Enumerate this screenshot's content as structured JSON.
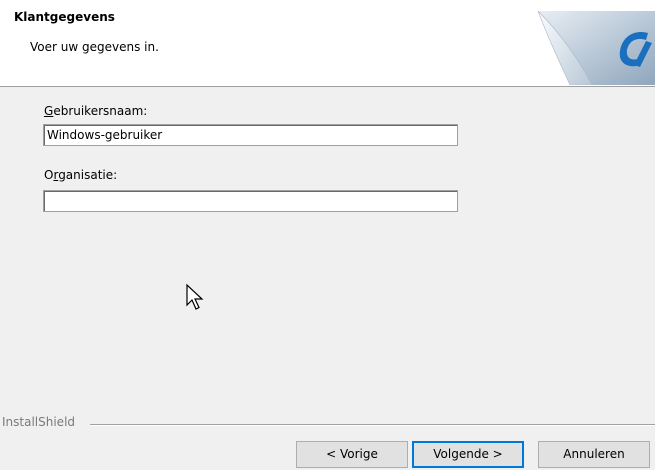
{
  "header": {
    "title": "Klantgegevens",
    "subtitle": "Voer uw gegevens in."
  },
  "form": {
    "username_label_accel": "G",
    "username_label_rest": "ebruikersnaam:",
    "username_value": "Windows-gebruiker",
    "org_label_pre": "O",
    "org_label_accel": "r",
    "org_label_rest": "ganisatie:",
    "org_value": ""
  },
  "footer": {
    "brand": "InstallShield",
    "back_label": "< Vorige",
    "next_label": "Volgende >",
    "cancel_label": "Annuleren"
  },
  "colors": {
    "accent": "#0078d7",
    "logo_blue": "#1a6fbf"
  },
  "icons": {
    "logo": "installshield-logo-icon",
    "cursor": "mouse-pointer-icon"
  }
}
